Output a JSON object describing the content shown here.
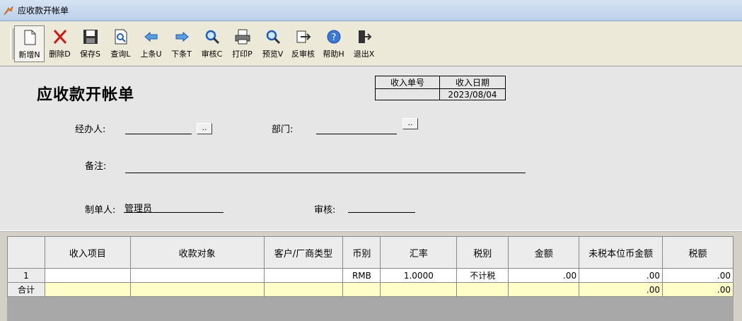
{
  "window": {
    "title": "应收款开帐单"
  },
  "toolbar": {
    "buttons": [
      {
        "label": "新增N",
        "icon": "new-document-icon"
      },
      {
        "label": "删除D",
        "icon": "delete-x-icon"
      },
      {
        "label": "保存S",
        "icon": "save-disk-icon"
      },
      {
        "label": "查询L",
        "icon": "query-magnifier-document-icon"
      },
      {
        "label": "上条U",
        "icon": "arrow-left-icon"
      },
      {
        "label": "下条T",
        "icon": "arrow-right-icon"
      },
      {
        "label": "审核C",
        "icon": "audit-magnifier-icon"
      },
      {
        "label": "打印P",
        "icon": "printer-icon"
      },
      {
        "label": "预览V",
        "icon": "preview-magnifier-icon"
      },
      {
        "label": "反审核",
        "icon": "unaudit-icon"
      },
      {
        "label": "帮助H",
        "icon": "help-icon"
      },
      {
        "label": "退出X",
        "icon": "exit-door-icon"
      }
    ]
  },
  "form": {
    "heading": "应收款开帐单",
    "info": {
      "number_header": "收入单号",
      "date_header": "收入日期",
      "number_value": "",
      "date_value": "2023/08/04"
    },
    "handler_label": "经办人:",
    "handler_value": "",
    "handler_button": "..",
    "dept_label": "部门:",
    "dept_value": "",
    "dept_button": "..",
    "remark_label": "备注:",
    "remark_value": "",
    "maker_label": "制单人:",
    "maker_value": "管理员",
    "auditor_label": "审核:",
    "auditor_value": ""
  },
  "grid": {
    "columns": [
      "",
      "收入项目",
      "收款对象",
      "客户/厂商类型",
      "币别",
      "汇率",
      "税别",
      "金额",
      "未税本位币金额",
      "税额"
    ],
    "rows": [
      [
        "1",
        "",
        "",
        "",
        "RMB",
        "1.0000",
        "不计税",
        ".00",
        ".00",
        ".00"
      ]
    ],
    "total": [
      "合计",
      "",
      "",
      "",
      "",
      "",
      "",
      "",
      ".00",
      ".00"
    ]
  },
  "colors": {
    "total_row": "#fffdc8",
    "titlebar": "#c8d8ee"
  }
}
